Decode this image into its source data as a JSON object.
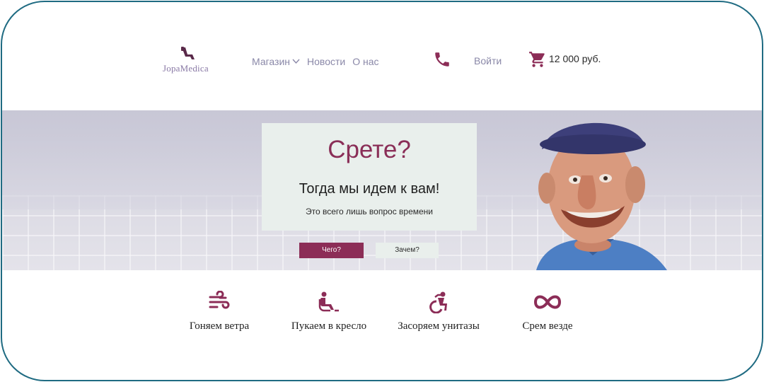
{
  "brand": {
    "name": "JopaMedica",
    "accent": "#8c2d57",
    "border": "#1f6b82",
    "logo_icon": "chair-icon"
  },
  "nav": {
    "items": [
      {
        "label": "Магазин",
        "has_dropdown": true
      },
      {
        "label": "Новости"
      },
      {
        "label": "О нас"
      }
    ],
    "phone_icon": "phone-icon",
    "login_label": "Войти",
    "cart_icon": "cart-icon",
    "cart_total": "12 000 руб."
  },
  "hero": {
    "title": "Срете?",
    "subtitle": "Тогда мы идем к вам!",
    "note": "Это всего лишь вопрос времени",
    "primary_button": "Чего?",
    "secondary_button": "Зачем?"
  },
  "features": [
    {
      "icon": "wind-icon",
      "label": "Гоняем ветра"
    },
    {
      "icon": "seated-person-icon",
      "label": "Пукаем в кресло"
    },
    {
      "icon": "wheelchair-icon",
      "label": "Засоряем унитазы"
    },
    {
      "icon": "infinity-icon",
      "label": "Срем везде"
    }
  ]
}
